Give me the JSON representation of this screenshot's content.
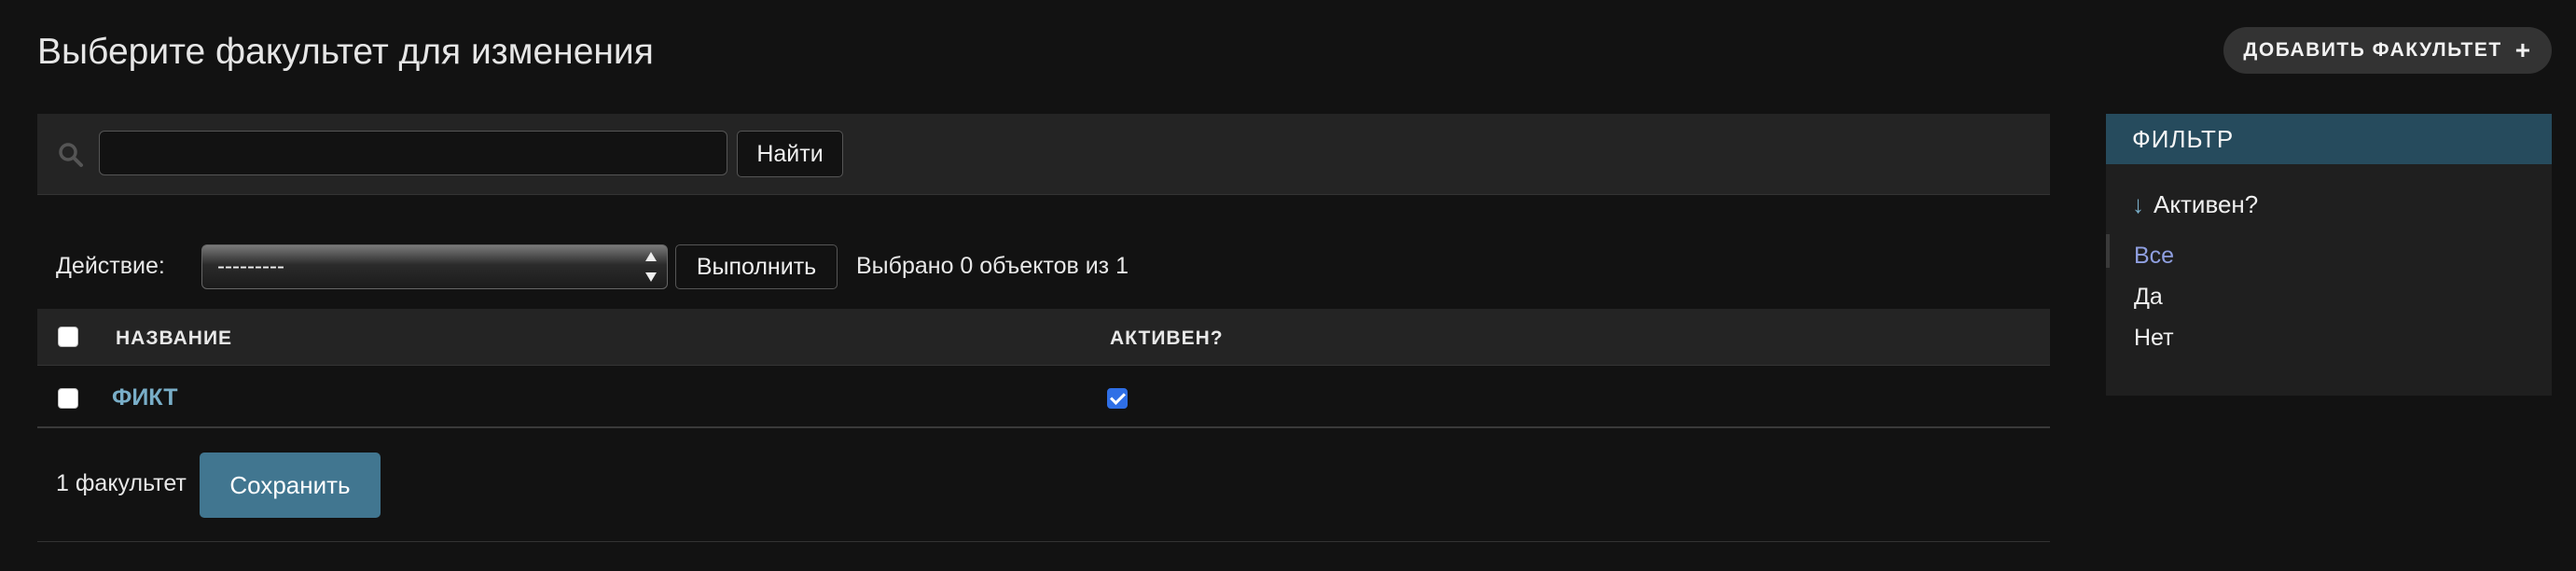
{
  "header": {
    "title": "Выберите факультет для изменения",
    "add_button_label": "Добавить факультет",
    "add_icon": "+"
  },
  "search": {
    "value": "",
    "placeholder": "",
    "button_label": "Найти"
  },
  "actions": {
    "label": "Действие:",
    "selected_option": "---------",
    "go_button_label": "Выполнить",
    "selection_text": "Выбрано 0 объектов из 1"
  },
  "table": {
    "columns": [
      "Название",
      "Активен?"
    ],
    "rows": [
      {
        "name": "ФИКТ",
        "active": true,
        "selected": false
      }
    ]
  },
  "footer": {
    "count_text": "1 факультет",
    "save_label": "Сохранить"
  },
  "filter": {
    "header": "Фильтр",
    "title": "Активен?",
    "arrow_icon": "↓",
    "options": [
      "Все",
      "Да",
      "Нет"
    ],
    "selected_index": 0
  },
  "colors": {
    "background": "#121212",
    "link": "#79aec8",
    "filter_header": "#264b5d",
    "primary_button": "#417690",
    "selected_filter": "#8f9fe0"
  }
}
